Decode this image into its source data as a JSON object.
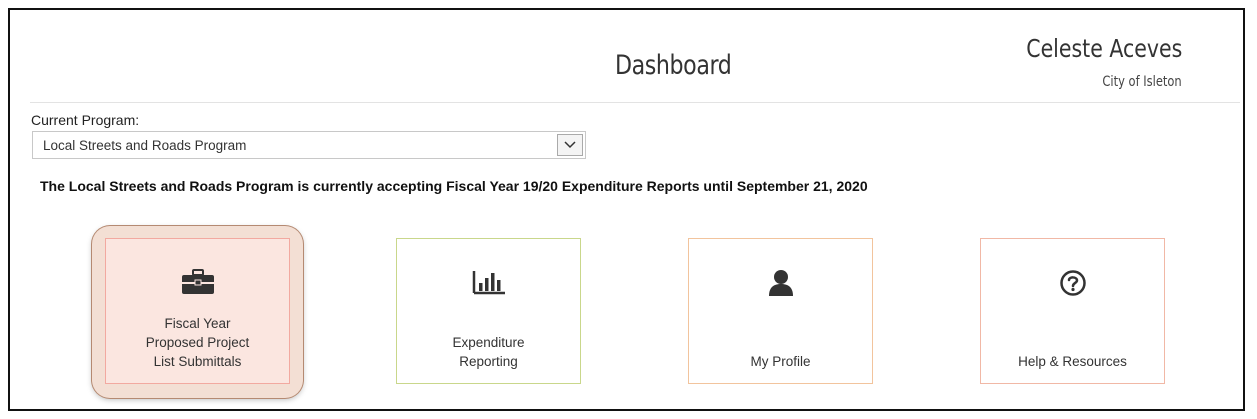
{
  "header": {
    "title": "Dashboard",
    "user_name": "Celeste Aceves",
    "user_org": "City of Isleton"
  },
  "program": {
    "label": "Current Program:",
    "selected": "Local Streets and Roads Program"
  },
  "notice": "The Local Streets and Roads Program is currently accepting Fiscal Year 19/20 Expenditure Reports until September 21, 2020",
  "tiles": [
    {
      "label_lines": [
        "Fiscal Year",
        "Proposed Project",
        "List Submittals"
      ],
      "icon": "briefcase-icon",
      "border": "#f2a9a0",
      "active": true
    },
    {
      "label_lines": [
        "Expenditure",
        "Reporting"
      ],
      "icon": "bar-chart-icon",
      "border": "#c9d78b",
      "active": false
    },
    {
      "label_lines": [
        "My Profile"
      ],
      "icon": "user-icon",
      "border": "#f2c49d",
      "active": false
    },
    {
      "label_lines": [
        "Help & Resources"
      ],
      "icon": "question-circle-icon",
      "border": "#f1b8a6",
      "active": false
    }
  ]
}
